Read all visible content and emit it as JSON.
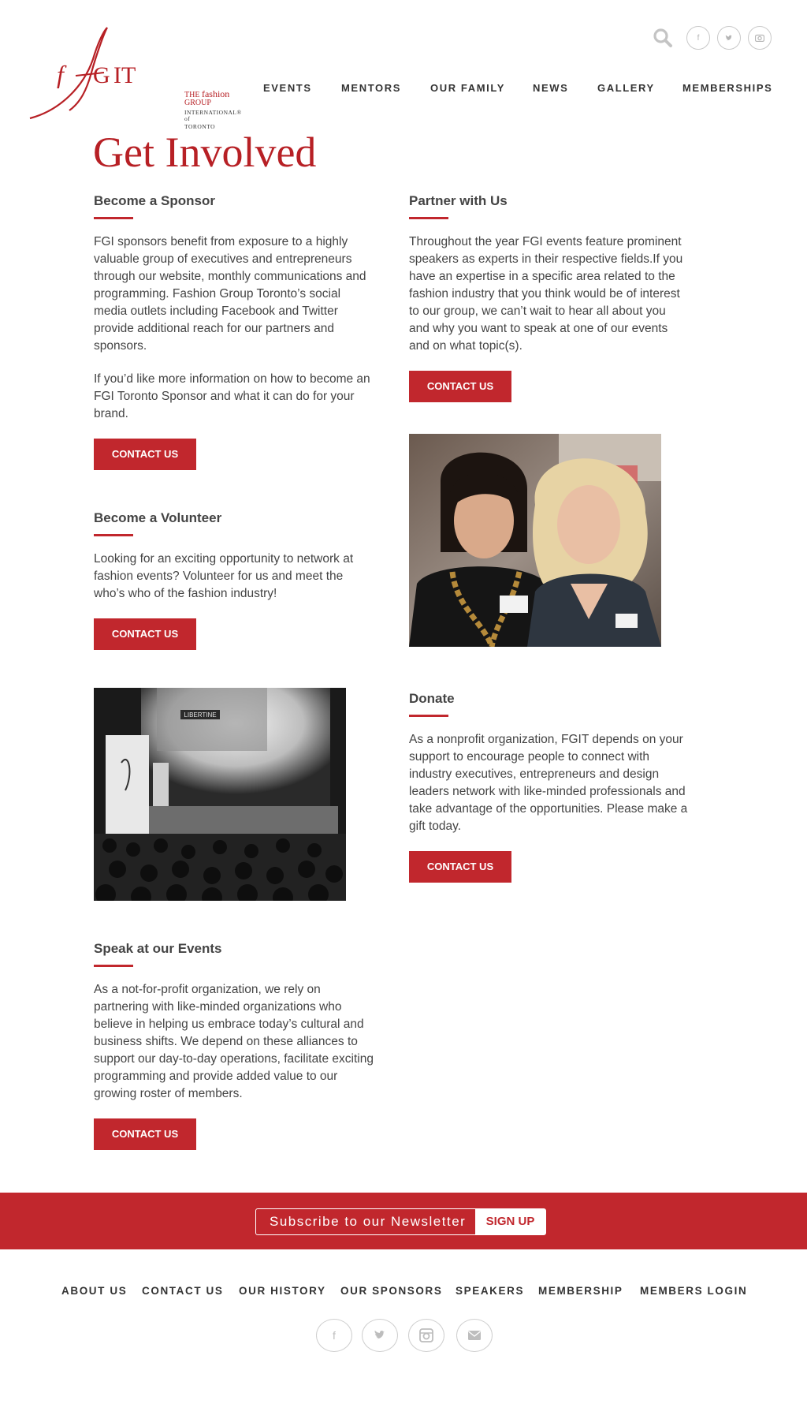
{
  "header": {
    "logo": {
      "line1_prefix": "THE ",
      "line1_brand": "fashion",
      "line1_suffix": " GROUP",
      "line2": "INTERNATIONAL® of",
      "line3": "TORONTO"
    },
    "icons": [
      "search-icon",
      "facebook-icon",
      "twitter-icon",
      "instagram-icon"
    ],
    "nav": [
      "EVENTS",
      "MENTORS",
      "OUR FAMILY",
      "NEWS",
      "GALLERY",
      "MEMBERSHIPS"
    ]
  },
  "main": {
    "title": "Get Involved",
    "sponsor": {
      "heading": "Become a Sponsor",
      "paragraphs": [
        "FGI sponsors benefit from exposure to a highly valuable group of executives and entrepreneurs through our website, monthly communications and programming. Fashion Group Toronto’s social media outlets including Facebook and Twitter provide additional reach for our partners and sponsors.",
        "If you’d like more information on how to become an FGI Toronto Sponsor and what it can do for your brand."
      ],
      "button": "CONTACT US"
    },
    "partner": {
      "heading": "Partner with Us",
      "paragraphs": [
        "Throughout the year FGI events feature prominent speakers as experts in their respective fields.If you have an expertise in a specific area related to the fashion industry that you think would be of interest to our group, we can’t wait to hear all about you and why you want to speak at one of our events and on what topic(s)."
      ],
      "button": "CONTACT US"
    },
    "volunteer": {
      "heading": "Become a Volunteer",
      "paragraphs": [
        "Looking for an exciting opportunity to network at fashion events? Volunteer for us and meet the who’s who of the fashion industry!"
      ],
      "button": "CONTACT US"
    },
    "donate": {
      "heading": "Donate",
      "paragraphs": [
        "As a nonprofit organization, FGIT depends on your support to encourage people to connect with industry executives, entrepreneurs and design leaders network with like-minded professionals and take advantage of the opportunities. Please make a gift today."
      ],
      "button": "CONTACT US"
    },
    "speak": {
      "heading": "Speak at our Events",
      "paragraphs": [
        "As a not-for-profit organization, we rely on partnering with like-minded organizations who believe in helping us embrace today’s cultural and business shifts. We depend on these alliances to support our day-to-day operations, facilitate exciting programming and provide added value to our growing roster of members."
      ],
      "button": "CONTACT US"
    },
    "photo_event_banner": "LIBERTINE"
  },
  "newsletter": {
    "placeholder": "Subscribe to our Newsletter",
    "button": "SIGN UP"
  },
  "footer": {
    "nav": [
      "ABOUT US",
      "CONTACT US",
      "OUR HISTORY",
      "OUR SPONSORS",
      "SPEAKERS",
      "MEMBERSHIP",
      "MEMBERS LOGIN"
    ],
    "social_icons": [
      "facebook-icon",
      "twitter-icon",
      "instagram-icon",
      "email-icon"
    ]
  },
  "colors": {
    "brand_red": "#c1272d",
    "text": "#444444",
    "background": "#ffffff"
  }
}
